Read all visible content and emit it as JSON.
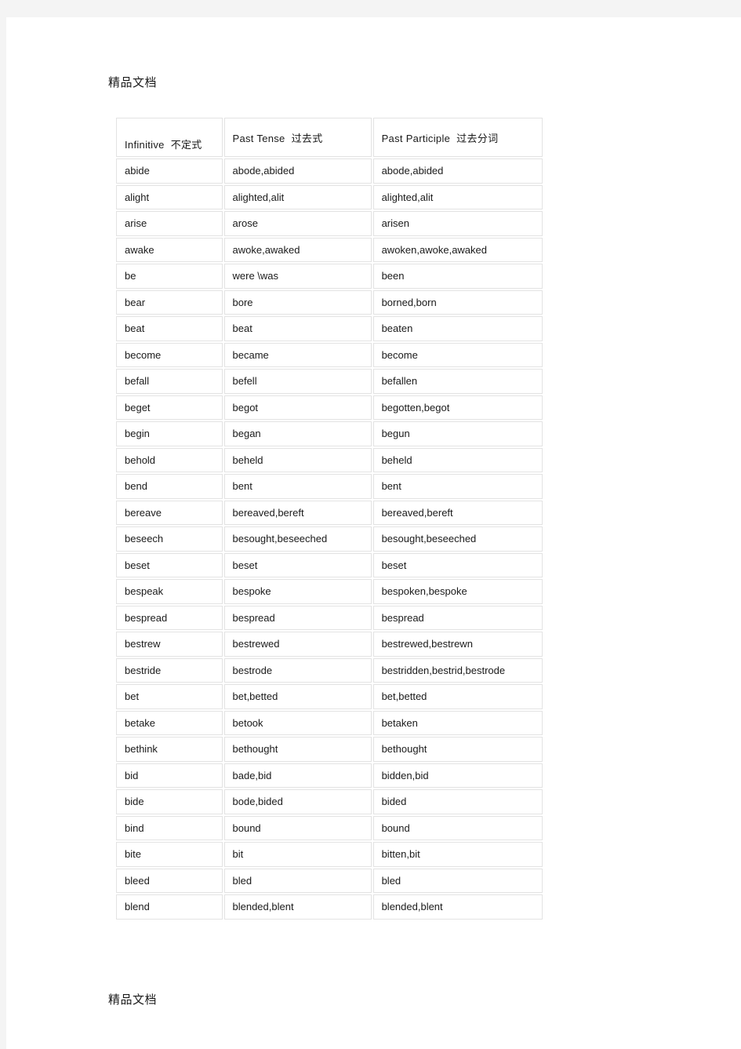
{
  "document": {
    "watermark_top": "精品文档",
    "watermark_bottom": "精品文档"
  },
  "table": {
    "headers": [
      {
        "en": "Infinitive",
        "zh": "不定式"
      },
      {
        "en": "Past  Tense",
        "zh": "过去式"
      },
      {
        "en": "Past  Participle",
        "zh": "过去分词"
      }
    ],
    "rows": [
      [
        "abide",
        "abode,abided",
        "abode,abided"
      ],
      [
        "alight",
        "alighted,alit",
        "alighted,alit"
      ],
      [
        "arise",
        "arose",
        "arisen"
      ],
      [
        "awake",
        "awoke,awaked",
        "awoken,awoke,awaked"
      ],
      [
        "be",
        "were  \\was",
        "been"
      ],
      [
        "bear",
        "bore",
        "borned,born"
      ],
      [
        "beat",
        "beat",
        "beaten"
      ],
      [
        "become",
        "became",
        "become"
      ],
      [
        "befall",
        "befell",
        "befallen"
      ],
      [
        "beget",
        "begot",
        "begotten,begot"
      ],
      [
        "begin",
        "began",
        "begun"
      ],
      [
        "behold",
        "beheld",
        "beheld"
      ],
      [
        "bend",
        "bent",
        "bent"
      ],
      [
        "bereave",
        "bereaved,bereft",
        "bereaved,bereft"
      ],
      [
        "beseech",
        "besought,beseeched",
        "besought,beseeched"
      ],
      [
        "beset",
        "beset",
        "beset"
      ],
      [
        "bespeak",
        "bespoke",
        "bespoken,bespoke"
      ],
      [
        "bespread",
        "bespread",
        "bespread"
      ],
      [
        "bestrew",
        "bestrewed",
        "bestrewed,bestrewn"
      ],
      [
        "bestride",
        "bestrode",
        "bestridden,bestrid,bestrode"
      ],
      [
        "bet",
        "bet,betted",
        "bet,betted"
      ],
      [
        "betake",
        "betook",
        "betaken"
      ],
      [
        "bethink",
        "bethought",
        "bethought"
      ],
      [
        "bid",
        "bade,bid",
        "bidden,bid"
      ],
      [
        "bide",
        "bode,bided",
        "bided"
      ],
      [
        "bind",
        "bound",
        "bound"
      ],
      [
        "bite",
        "bit",
        "bitten,bit"
      ],
      [
        "bleed",
        "bled",
        "bled"
      ],
      [
        "blend",
        "blended,blent",
        "blended,blent"
      ]
    ]
  },
  "colors": {
    "page_background": "#ffffff",
    "canvas_background": "#f4f4f4",
    "cell_border": "#e3e3e3",
    "text": "#1a1a1a"
  }
}
